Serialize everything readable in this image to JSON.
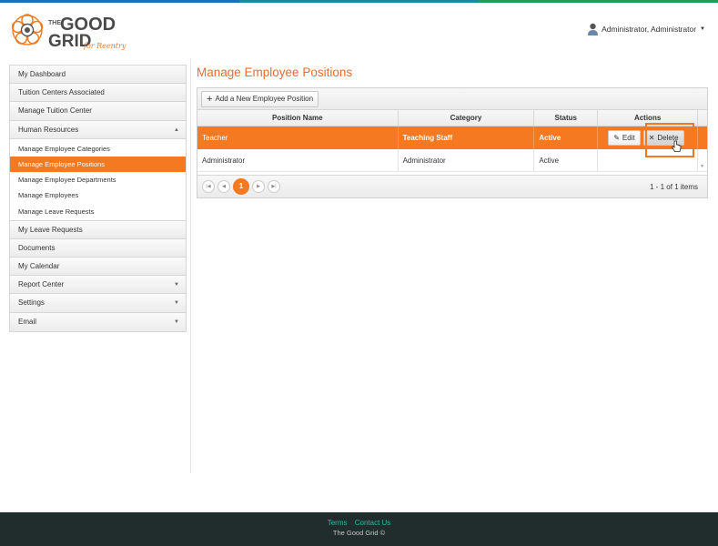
{
  "colors": {
    "accent": "#f47920",
    "title": "#f26a2d",
    "footer_bg": "#212c2c",
    "footer_link": "#2fb9a6",
    "strip": [
      "#1f6fb6",
      "#1f6fb6",
      "#1a8a9e",
      "#1a8a9e",
      "#1f9d55",
      "#1f9d55"
    ]
  },
  "brand": {
    "line1": "THE",
    "good": "GOOD",
    "grid": "GRID",
    "tagline": "for Reentry"
  },
  "user": {
    "name": "Administrator, Administrator",
    "icon": "user-avatar-icon"
  },
  "sidebar": {
    "items": [
      {
        "label": "My Dashboard"
      },
      {
        "label": "Tuition Centers Associated"
      },
      {
        "label": "Manage Tuition Center"
      },
      {
        "label": "Human Resources",
        "caret": "▲"
      }
    ],
    "sub": [
      {
        "label": "Manage Employee Categories"
      },
      {
        "label": "Manage Employee Positions"
      },
      {
        "label": "Manage Employee Departments"
      },
      {
        "label": "Manage Employees"
      },
      {
        "label": "Manage Leave Requests"
      }
    ],
    "items2": [
      {
        "label": "My Leave Requests"
      },
      {
        "label": "Documents"
      },
      {
        "label": "My Calendar"
      },
      {
        "label": "Report Center",
        "caret": "▼"
      },
      {
        "label": "Settings",
        "caret": "▼"
      },
      {
        "label": "Email",
        "caret": "▼"
      }
    ]
  },
  "page": {
    "title": "Manage Employee Positions"
  },
  "grid": {
    "add_label": "Add a New Employee Position",
    "columns": [
      "Position Name",
      "Category",
      "Status",
      "Actions"
    ],
    "rows": [
      {
        "name": "Teacher",
        "category": "Teaching Staff",
        "status": "Active"
      },
      {
        "name": "Administrator",
        "category": "Administrator",
        "status": "Active"
      }
    ],
    "edit_label": "Edit",
    "delete_label": "Delete",
    "pager": {
      "current": "1",
      "info": "1 - 1 of 1 items"
    }
  },
  "footer": {
    "terms": "Terms",
    "contact": "Contact Us",
    "copyright": "The Good Grid ©"
  }
}
